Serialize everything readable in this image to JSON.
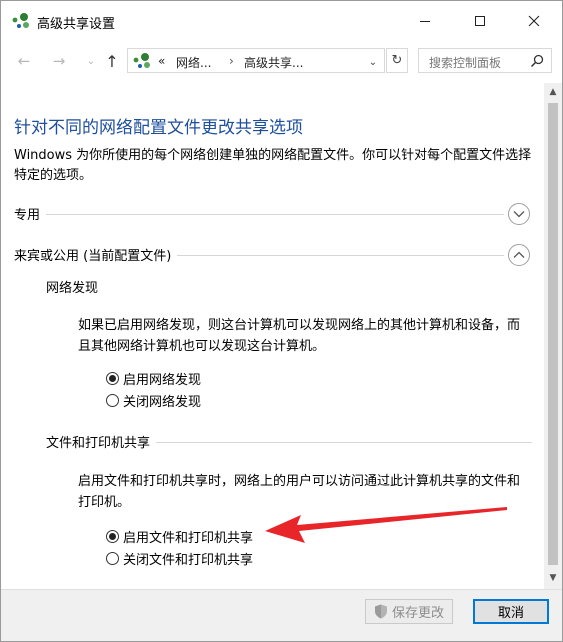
{
  "window": {
    "title": "高级共享设置"
  },
  "navbar": {
    "address_segments": [
      "«",
      "网络...",
      "高级共享..."
    ],
    "search_placeholder": "搜索控制面板"
  },
  "content": {
    "heading": "针对不同的网络配置文件更改共享选项",
    "intro": "Windows 为你所使用的每个网络创建单独的网络配置文件。你可以针对每个配置文件选择特定的选项。",
    "profiles": [
      {
        "label": "专用",
        "expanded": false
      },
      {
        "label": "来宾或公用 (当前配置文件)",
        "expanded": true,
        "sections": [
          {
            "label": "网络发现",
            "description": "如果已启用网络发现，则这台计算机可以发现网络上的其他计算机和设备，而且其他网络计算机也可以发现这台计算机。",
            "options": [
              {
                "label": "启用网络发现",
                "checked": true
              },
              {
                "label": "关闭网络发现",
                "checked": false
              }
            ]
          },
          {
            "label": "文件和打印机共享",
            "description": "启用文件和打印机共享时，网络上的用户可以访问通过此计算机共享的文件和打印机。",
            "options": [
              {
                "label": "启用文件和打印机共享",
                "checked": true
              },
              {
                "label": "关闭文件和打印机共享",
                "checked": false
              }
            ]
          }
        ]
      }
    ]
  },
  "footer": {
    "save_label": "保存更改",
    "cancel_label": "取消"
  },
  "colors": {
    "heading": "#1e4f9c",
    "focus_border": "#0078d7",
    "annotation_arrow": "#e8262a"
  },
  "icons": {
    "app": "network-icon",
    "shield": "uac-shield-icon"
  }
}
